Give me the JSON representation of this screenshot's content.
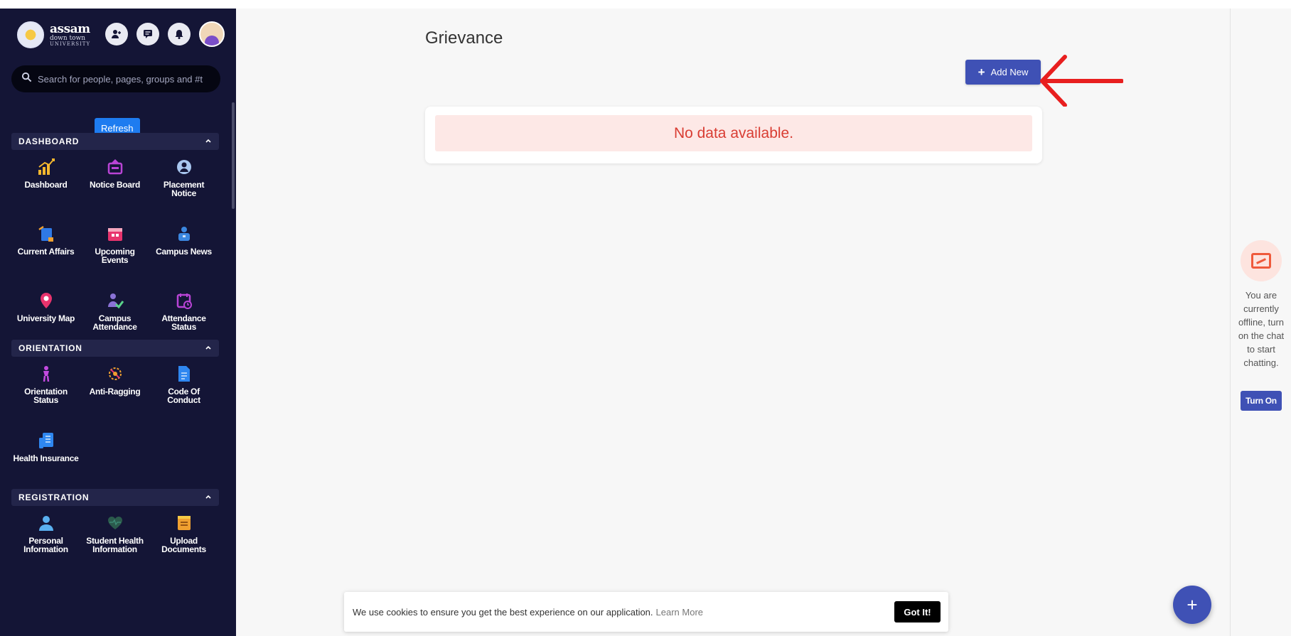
{
  "logo": {
    "line1": "assam",
    "line2": "down town",
    "line3": "UNIVERSITY"
  },
  "search": {
    "placeholder": "Search for people, pages, groups and #t"
  },
  "refresh_label": "Refresh",
  "sections": [
    {
      "title": "DASHBOARD",
      "items": [
        {
          "label": "Dashboard",
          "icon": "chart-up-icon",
          "color": "#f5b82e"
        },
        {
          "label": "Notice Board",
          "icon": "notice-board-icon",
          "color": "#b944d6"
        },
        {
          "label": "Placement Notice",
          "icon": "placement-icon",
          "color": "#a9c7f0"
        },
        {
          "label": "Current Affairs",
          "icon": "current-affairs-icon",
          "color": "#2f79e6"
        },
        {
          "label": "Upcoming Events",
          "icon": "calendar-icon",
          "color": "#e8336d"
        },
        {
          "label": "Campus News",
          "icon": "news-icon",
          "color": "#3b87e0"
        },
        {
          "label": "University Map",
          "icon": "map-pin-icon",
          "color": "#e8336d"
        },
        {
          "label": "Campus Attendance",
          "icon": "attendance-user-icon",
          "color": "#5ad38a"
        },
        {
          "label": "Attendance Status",
          "icon": "attendance-calendar-icon",
          "color": "#b944d6"
        }
      ]
    },
    {
      "title": "ORIENTATION",
      "items": [
        {
          "label": "Orientation Status",
          "icon": "orientation-icon",
          "color": "#c34ae0"
        },
        {
          "label": "Anti-Ragging",
          "icon": "anti-ragging-icon",
          "color": "#f0a030"
        },
        {
          "label": "Code Of Conduct",
          "icon": "document-icon",
          "color": "#2f87f0"
        },
        {
          "label": "Health Insurance",
          "icon": "health-insurance-icon",
          "color": "#2f87f0"
        }
      ]
    },
    {
      "title": "REGISTRATION",
      "items": [
        {
          "label": "Personal Information",
          "icon": "person-icon",
          "color": "#5ab0f0"
        },
        {
          "label": "Student Health Information",
          "icon": "heart-icon",
          "color": "#2b5a4c"
        },
        {
          "label": "Upload Documents",
          "icon": "upload-icon",
          "color": "#f0a030"
        }
      ]
    }
  ],
  "page": {
    "title": "Grievance",
    "add_new_label": "Add New",
    "empty_message": "No data available."
  },
  "cookie": {
    "text": "We use cookies to ensure you get the best experience on our application.",
    "learn_more": "Learn More",
    "button": "Got It!"
  },
  "chat": {
    "offline_text": "You are currently offline, turn on the chat to start chatting.",
    "turn_on_label": "Turn On"
  },
  "colors": {
    "sidebar_bg": "#141536",
    "primary": "#3f51b5",
    "error": "#d93d33",
    "annotation_arrow": "#e81f1f"
  }
}
